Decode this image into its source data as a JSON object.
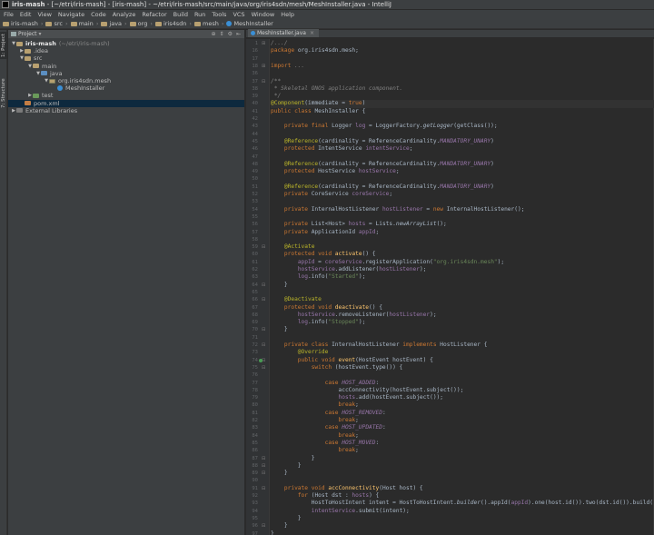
{
  "window": {
    "title_bold": "iris-mash",
    "title_rest": " - [~/etri/iris-mash] - [iris-mash] - ~/etri/iris-mash/src/main/java/org/iris4sdn/mesh/MeshInstaller.java - IntelliJ"
  },
  "menu": [
    "File",
    "Edit",
    "View",
    "Navigate",
    "Code",
    "Analyze",
    "Refactor",
    "Build",
    "Run",
    "Tools",
    "VCS",
    "Window",
    "Help"
  ],
  "breadcrumb": [
    "iris-mash",
    "src",
    "main",
    "java",
    "org",
    "iris4sdn",
    "mesh",
    "MeshInstaller"
  ],
  "left_tabs": {
    "project": "1: Project",
    "structure": "7: Structure"
  },
  "project_panel": {
    "header": "Project",
    "tree": [
      {
        "label": "iris-mash",
        "suffix": "(~/etri/iris-mash)",
        "icon": "module-folder",
        "depth": 0,
        "expanded": true,
        "bold": true
      },
      {
        "label": ".idea",
        "icon": "folder",
        "depth": 1,
        "expanded": false
      },
      {
        "label": "src",
        "icon": "folder",
        "depth": 1,
        "expanded": true
      },
      {
        "label": "main",
        "icon": "folder",
        "depth": 2,
        "expanded": true
      },
      {
        "label": "java",
        "icon": "source-folder",
        "depth": 3,
        "expanded": true
      },
      {
        "label": "org.iris4sdn.mesh",
        "icon": "package",
        "depth": 4,
        "expanded": true
      },
      {
        "label": "MeshInstaller",
        "icon": "class",
        "depth": 5,
        "expanded": null
      },
      {
        "label": "test",
        "icon": "test-folder",
        "depth": 2,
        "expanded": false
      },
      {
        "label": "pom.xml",
        "icon": "maven-file",
        "depth": 1,
        "expanded": null,
        "selected": true
      },
      {
        "label": "External Libraries",
        "icon": "library",
        "depth": 0,
        "expanded": false
      }
    ]
  },
  "editor": {
    "tab_label": "MeshInstaller.java",
    "current_line": 40,
    "lines": [
      {
        "n": "1",
        "fold": "+",
        "s": [
          [
            "/.../",
            "c"
          ]
        ]
      },
      {
        "n": "16",
        "s": [
          [
            "package ",
            "k"
          ],
          [
            "org.iris4sdn.mesh;",
            ""
          ]
        ]
      },
      {
        "n": "17",
        "s": []
      },
      {
        "n": "18",
        "fold": "+",
        "s": [
          [
            "import ",
            "k"
          ],
          [
            "...",
            "c"
          ]
        ]
      },
      {
        "n": "36",
        "s": []
      },
      {
        "n": "37",
        "fold": "-",
        "s": [
          [
            "/**",
            "c"
          ]
        ]
      },
      {
        "n": "38",
        "s": [
          [
            " * Skeletal ONOS application component.",
            "c"
          ]
        ]
      },
      {
        "n": "39",
        "s": [
          [
            " */",
            "c"
          ]
        ]
      },
      {
        "n": "40",
        "s": [
          [
            "@Component",
            "a"
          ],
          [
            "(immediate = ",
            ""
          ],
          [
            "true",
            "k"
          ],
          [
            ")",
            ""
          ]
        ]
      },
      {
        "n": "41",
        "s": [
          [
            "public class ",
            "k"
          ],
          [
            "MeshInstaller {",
            ""
          ]
        ]
      },
      {
        "n": "42",
        "s": []
      },
      {
        "n": "43",
        "s": [
          [
            "    private final ",
            "k"
          ],
          [
            "Logger ",
            ""
          ],
          [
            "log",
            "f"
          ],
          [
            " = LoggerFactory.",
            ""
          ],
          [
            "getLogger",
            "i"
          ],
          [
            "(getClass());",
            ""
          ]
        ]
      },
      {
        "n": "44",
        "s": []
      },
      {
        "n": "45",
        "s": [
          [
            "    @Reference",
            "a"
          ],
          [
            "(cardinality = ReferenceCardinality.",
            ""
          ],
          [
            "MANDATORY_UNARY",
            "sf"
          ],
          [
            ")",
            ""
          ]
        ]
      },
      {
        "n": "46",
        "s": [
          [
            "    protected ",
            "k"
          ],
          [
            "IntentService ",
            ""
          ],
          [
            "intentService",
            "f"
          ],
          [
            ";",
            ""
          ]
        ]
      },
      {
        "n": "47",
        "s": []
      },
      {
        "n": "48",
        "s": [
          [
            "    @Reference",
            "a"
          ],
          [
            "(cardinality = ReferenceCardinality.",
            ""
          ],
          [
            "MANDATORY_UNARY",
            "sf"
          ],
          [
            ")",
            ""
          ]
        ]
      },
      {
        "n": "49",
        "s": [
          [
            "    protected ",
            "k"
          ],
          [
            "HostService ",
            ""
          ],
          [
            "hostService",
            "f"
          ],
          [
            ";",
            ""
          ]
        ]
      },
      {
        "n": "50",
        "s": []
      },
      {
        "n": "51",
        "s": [
          [
            "    @Reference",
            "a"
          ],
          [
            "(cardinality = ReferenceCardinality.",
            ""
          ],
          [
            "MANDATORY_UNARY",
            "sf"
          ],
          [
            ")",
            ""
          ]
        ]
      },
      {
        "n": "52",
        "s": [
          [
            "    private ",
            "k"
          ],
          [
            "CoreService ",
            ""
          ],
          [
            "coreService",
            "f"
          ],
          [
            ";",
            ""
          ]
        ]
      },
      {
        "n": "53",
        "s": []
      },
      {
        "n": "54",
        "s": [
          [
            "    private ",
            "k"
          ],
          [
            "InternalHostListener ",
            ""
          ],
          [
            "hostListener",
            "f"
          ],
          [
            " = ",
            ""
          ],
          [
            "new ",
            "k"
          ],
          [
            "InternalHostListener();",
            ""
          ]
        ]
      },
      {
        "n": "55",
        "s": []
      },
      {
        "n": "56",
        "s": [
          [
            "    private ",
            "k"
          ],
          [
            "List<Host> ",
            ""
          ],
          [
            "hosts",
            "f"
          ],
          [
            " = Lists.",
            ""
          ],
          [
            "newArrayList",
            "i"
          ],
          [
            "();",
            ""
          ]
        ]
      },
      {
        "n": "57",
        "s": [
          [
            "    private ",
            "k"
          ],
          [
            "ApplicationId ",
            ""
          ],
          [
            "appId",
            "f"
          ],
          [
            ";",
            ""
          ]
        ]
      },
      {
        "n": "58",
        "s": []
      },
      {
        "n": "59",
        "fold": "-",
        "s": [
          [
            "    @Activate",
            "a"
          ]
        ]
      },
      {
        "n": "60",
        "s": [
          [
            "    protected void ",
            "k"
          ],
          [
            "activate",
            "m"
          ],
          [
            "() {",
            ""
          ]
        ]
      },
      {
        "n": "61",
        "s": [
          [
            "        ",
            ""
          ],
          [
            "appId",
            "f"
          ],
          [
            " = ",
            ""
          ],
          [
            "coreService",
            "f"
          ],
          [
            ".registerApplication(",
            ""
          ],
          [
            "\"org.iris4sdn.mesh\"",
            "s"
          ],
          [
            ");",
            ""
          ]
        ]
      },
      {
        "n": "62",
        "s": [
          [
            "        ",
            ""
          ],
          [
            "hostService",
            "f"
          ],
          [
            ".addListener(",
            ""
          ],
          [
            "hostListener",
            "f"
          ],
          [
            ");",
            ""
          ]
        ]
      },
      {
        "n": "63",
        "s": [
          [
            "        ",
            ""
          ],
          [
            "log",
            "f"
          ],
          [
            ".info(",
            ""
          ],
          [
            "\"Started\"",
            "s"
          ],
          [
            ");",
            ""
          ]
        ]
      },
      {
        "n": "64",
        "fold": "-",
        "s": [
          [
            "    }",
            ""
          ]
        ]
      },
      {
        "n": "65",
        "s": []
      },
      {
        "n": "66",
        "fold": "-",
        "s": [
          [
            "    @Deactivate",
            "a"
          ]
        ]
      },
      {
        "n": "67",
        "s": [
          [
            "    protected void ",
            "k"
          ],
          [
            "deactivate",
            "m"
          ],
          [
            "() {",
            ""
          ]
        ]
      },
      {
        "n": "68",
        "s": [
          [
            "        ",
            ""
          ],
          [
            "hostService",
            "f"
          ],
          [
            ".removeListener(",
            ""
          ],
          [
            "hostListener",
            "f"
          ],
          [
            ");",
            ""
          ]
        ]
      },
      {
        "n": "69",
        "s": [
          [
            "        ",
            ""
          ],
          [
            "log",
            "f"
          ],
          [
            ".info(",
            ""
          ],
          [
            "\"Stopped\"",
            "s"
          ],
          [
            ");",
            ""
          ]
        ]
      },
      {
        "n": "70",
        "fold": "-",
        "s": [
          [
            "    }",
            ""
          ]
        ]
      },
      {
        "n": "71",
        "s": []
      },
      {
        "n": "72",
        "fold": "-",
        "s": [
          [
            "    private class ",
            "k"
          ],
          [
            "InternalHostListener ",
            ""
          ],
          [
            "implements ",
            "k"
          ],
          [
            "HostListener {",
            ""
          ]
        ]
      },
      {
        "n": "73",
        "s": [
          [
            "        @Override",
            "a"
          ]
        ]
      },
      {
        "n": "74",
        "bp": true,
        "fold": "-",
        "s": [
          [
            "        public void ",
            "k"
          ],
          [
            "event",
            "m"
          ],
          [
            "(HostEvent hostEvent) {",
            ""
          ]
        ]
      },
      {
        "n": "75",
        "fold": "-",
        "s": [
          [
            "            ",
            ""
          ],
          [
            "switch ",
            "k"
          ],
          [
            "(hostEvent.type()) {",
            ""
          ]
        ]
      },
      {
        "n": "76",
        "s": []
      },
      {
        "n": "77",
        "s": [
          [
            "                ",
            ""
          ],
          [
            "case ",
            "k"
          ],
          [
            "HOST_ADDED",
            "sf"
          ],
          [
            ":",
            ""
          ]
        ]
      },
      {
        "n": "78",
        "s": [
          [
            "                    accConnectivity(hostEvent.subject());",
            ""
          ]
        ]
      },
      {
        "n": "79",
        "s": [
          [
            "                    ",
            ""
          ],
          [
            "hosts",
            "f"
          ],
          [
            ".add(hostEvent.subject());",
            ""
          ]
        ]
      },
      {
        "n": "80",
        "s": [
          [
            "                    ",
            ""
          ],
          [
            "break",
            "k"
          ],
          [
            ";",
            ""
          ]
        ]
      },
      {
        "n": "81",
        "s": [
          [
            "                ",
            ""
          ],
          [
            "case ",
            "k"
          ],
          [
            "HOST_REMOVED",
            "sf"
          ],
          [
            ":",
            ""
          ]
        ]
      },
      {
        "n": "82",
        "s": [
          [
            "                    ",
            ""
          ],
          [
            "break",
            "k"
          ],
          [
            ";",
            ""
          ]
        ]
      },
      {
        "n": "83",
        "s": [
          [
            "                ",
            ""
          ],
          [
            "case ",
            "k"
          ],
          [
            "HOST_UPDATED",
            "sf"
          ],
          [
            ":",
            ""
          ]
        ]
      },
      {
        "n": "84",
        "s": [
          [
            "                    ",
            ""
          ],
          [
            "break",
            "k"
          ],
          [
            ";",
            ""
          ]
        ]
      },
      {
        "n": "85",
        "s": [
          [
            "                ",
            ""
          ],
          [
            "case ",
            "k"
          ],
          [
            "HOST_MOVED",
            "sf"
          ],
          [
            ":",
            ""
          ]
        ]
      },
      {
        "n": "86",
        "s": [
          [
            "                    ",
            ""
          ],
          [
            "break",
            "k"
          ],
          [
            ";",
            ""
          ]
        ]
      },
      {
        "n": "87",
        "fold": "-",
        "s": [
          [
            "            }",
            ""
          ]
        ]
      },
      {
        "n": "88",
        "fold": "-",
        "s": [
          [
            "        }",
            ""
          ]
        ]
      },
      {
        "n": "89",
        "fold": "-",
        "s": [
          [
            "    }",
            ""
          ]
        ]
      },
      {
        "n": "90",
        "s": []
      },
      {
        "n": "91",
        "fold": "-",
        "s": [
          [
            "    private void ",
            "k"
          ],
          [
            "accConnectivity",
            "m"
          ],
          [
            "(Host host) {",
            ""
          ]
        ]
      },
      {
        "n": "92",
        "s": [
          [
            "        ",
            ""
          ],
          [
            "for ",
            "k"
          ],
          [
            "(Host dst : ",
            ""
          ],
          [
            "hosts",
            "f"
          ],
          [
            ") {",
            ""
          ]
        ]
      },
      {
        "n": "93",
        "s": [
          [
            "            HostToHostIntent intent = HostToHostIntent.",
            ""
          ],
          [
            "builder",
            "i"
          ],
          [
            "().appId(",
            ""
          ],
          [
            "appId",
            "f"
          ],
          [
            ").one(host.id()).two(dst.id()).build();",
            ""
          ]
        ]
      },
      {
        "n": "94",
        "s": [
          [
            "            ",
            ""
          ],
          [
            "intentService",
            "f"
          ],
          [
            ".submit(intent);",
            ""
          ]
        ]
      },
      {
        "n": "95",
        "s": [
          [
            "        }",
            ""
          ]
        ]
      },
      {
        "n": "96",
        "fold": "-",
        "s": [
          [
            "    }",
            ""
          ]
        ]
      },
      {
        "n": "97",
        "s": [
          [
            "}",
            ""
          ]
        ]
      }
    ]
  }
}
